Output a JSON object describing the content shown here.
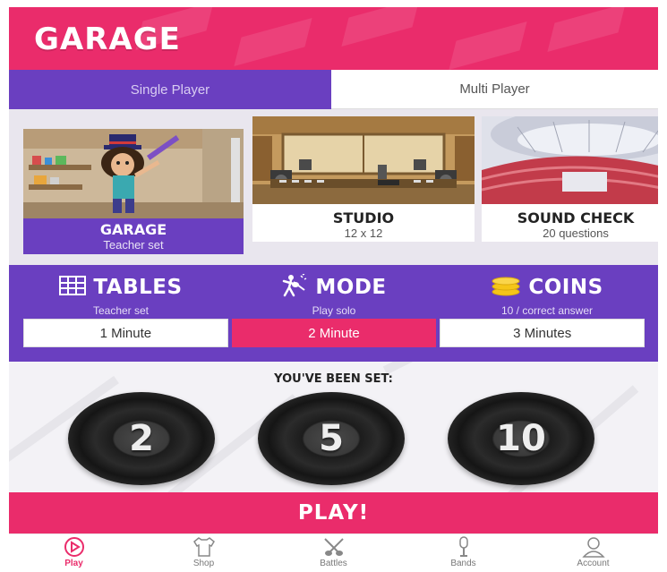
{
  "header": {
    "title": "GARAGE"
  },
  "tabs": [
    {
      "label": "Single Player",
      "active": true
    },
    {
      "label": "Multi Player",
      "active": false
    }
  ],
  "levels": [
    {
      "name": "GARAGE",
      "sub": "Teacher set",
      "selected": true
    },
    {
      "name": "STUDIO",
      "sub": "12 x 12",
      "selected": false
    },
    {
      "name": "SOUND CHECK",
      "sub": "20 questions",
      "selected": false
    }
  ],
  "info": {
    "tables": {
      "title": "TABLES",
      "sub": "Teacher set",
      "icon": "tables-icon"
    },
    "mode": {
      "title": "MODE",
      "sub": "Play solo",
      "icon": "guitarist-icon"
    },
    "coins": {
      "title": "COINS",
      "sub": "10 / correct answer",
      "icon": "coins-icon"
    }
  },
  "durations": [
    {
      "label": "1 Minute",
      "selected": false
    },
    {
      "label": "2 Minute",
      "selected": true
    },
    {
      "label": "3 Minutes",
      "selected": false
    }
  ],
  "set": {
    "title": "YOU'VE BEEN SET:",
    "records": [
      "2",
      "5",
      "10"
    ]
  },
  "play": {
    "label": "PLAY!"
  },
  "nav": [
    {
      "label": "Play",
      "icon": "play-icon",
      "active": true
    },
    {
      "label": "Shop",
      "icon": "shirt-icon",
      "active": false
    },
    {
      "label": "Battles",
      "icon": "crossed-guitars-icon",
      "active": false
    },
    {
      "label": "Bands",
      "icon": "microphone-icon",
      "active": false
    },
    {
      "label": "Account",
      "icon": "user-icon",
      "active": false
    }
  ],
  "colors": {
    "pink": "#ea2c6b",
    "purple": "#6a3fc0",
    "coin": "#f5c518"
  }
}
